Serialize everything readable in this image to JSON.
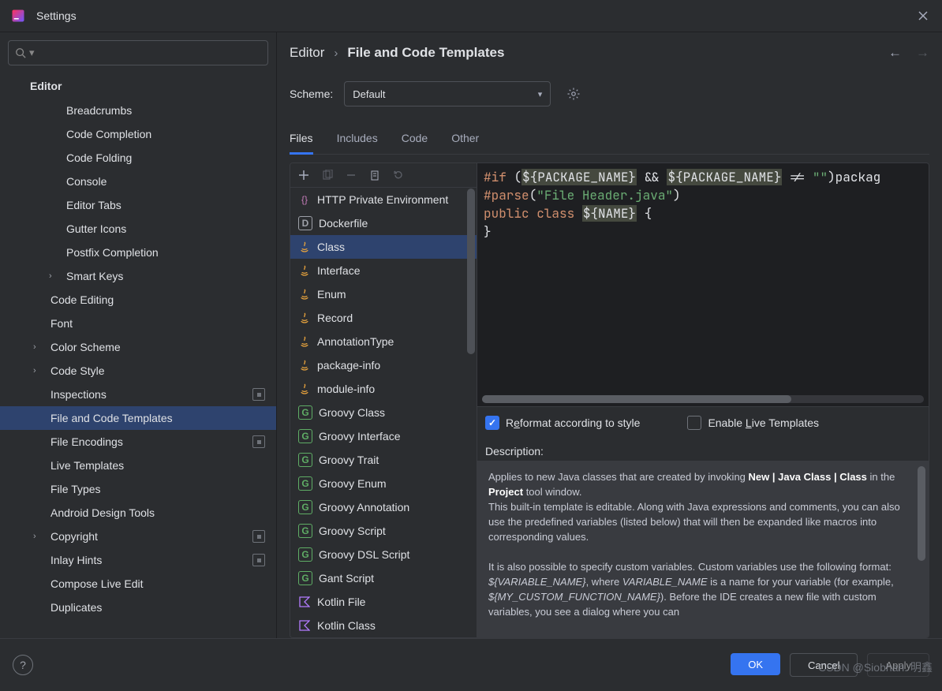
{
  "window": {
    "title": "Settings"
  },
  "search": {
    "placeholder": ""
  },
  "sidebar": {
    "header": "Editor",
    "items": [
      {
        "label": "Breadcrumbs",
        "depth": 2,
        "exp": null,
        "badge": false
      },
      {
        "label": "Code Completion",
        "depth": 2,
        "exp": null,
        "badge": false
      },
      {
        "label": "Code Folding",
        "depth": 2,
        "exp": null,
        "badge": false
      },
      {
        "label": "Console",
        "depth": 2,
        "exp": null,
        "badge": false
      },
      {
        "label": "Editor Tabs",
        "depth": 2,
        "exp": null,
        "badge": false
      },
      {
        "label": "Gutter Icons",
        "depth": 2,
        "exp": null,
        "badge": false
      },
      {
        "label": "Postfix Completion",
        "depth": 2,
        "exp": null,
        "badge": false
      },
      {
        "label": "Smart Keys",
        "depth": 2,
        "exp": ">",
        "badge": false
      },
      {
        "label": "Code Editing",
        "depth": 1,
        "exp": null,
        "badge": false
      },
      {
        "label": "Font",
        "depth": 1,
        "exp": null,
        "badge": false
      },
      {
        "label": "Color Scheme",
        "depth": 1,
        "exp": ">",
        "badge": false
      },
      {
        "label": "Code Style",
        "depth": 1,
        "exp": ">",
        "badge": false
      },
      {
        "label": "Inspections",
        "depth": 1,
        "exp": null,
        "badge": true
      },
      {
        "label": "File and Code Templates",
        "depth": 1,
        "exp": null,
        "badge": false,
        "selected": true
      },
      {
        "label": "File Encodings",
        "depth": 1,
        "exp": null,
        "badge": true
      },
      {
        "label": "Live Templates",
        "depth": 1,
        "exp": null,
        "badge": false
      },
      {
        "label": "File Types",
        "depth": 1,
        "exp": null,
        "badge": false
      },
      {
        "label": "Android Design Tools",
        "depth": 1,
        "exp": null,
        "badge": false
      },
      {
        "label": "Copyright",
        "depth": 1,
        "exp": ">",
        "badge": true
      },
      {
        "label": "Inlay Hints",
        "depth": 1,
        "exp": null,
        "badge": true
      },
      {
        "label": "Compose Live Edit",
        "depth": 1,
        "exp": null,
        "badge": false
      },
      {
        "label": "Duplicates",
        "depth": 1,
        "exp": null,
        "badge": false
      }
    ]
  },
  "breadcrumb": {
    "root": "Editor",
    "leaf": "File and Code Templates"
  },
  "scheme": {
    "label": "Scheme:",
    "value": "Default"
  },
  "tabs": [
    "Files",
    "Includes",
    "Code",
    "Other"
  ],
  "tabs_active": 0,
  "templates": [
    {
      "label": "HTTP Private Environment",
      "icon": "http"
    },
    {
      "label": "Dockerfile",
      "icon": "docker"
    },
    {
      "label": "Class",
      "icon": "java",
      "selected": true
    },
    {
      "label": "Interface",
      "icon": "java"
    },
    {
      "label": "Enum",
      "icon": "java"
    },
    {
      "label": "Record",
      "icon": "java"
    },
    {
      "label": "AnnotationType",
      "icon": "java"
    },
    {
      "label": "package-info",
      "icon": "java"
    },
    {
      "label": "module-info",
      "icon": "java"
    },
    {
      "label": "Groovy Class",
      "icon": "groovy"
    },
    {
      "label": "Groovy Interface",
      "icon": "groovy"
    },
    {
      "label": "Groovy Trait",
      "icon": "groovy"
    },
    {
      "label": "Groovy Enum",
      "icon": "groovy"
    },
    {
      "label": "Groovy Annotation",
      "icon": "groovy"
    },
    {
      "label": "Groovy Script",
      "icon": "groovy"
    },
    {
      "label": "Groovy DSL Script",
      "icon": "groovy"
    },
    {
      "label": "Gant Script",
      "icon": "groovy"
    },
    {
      "label": "Kotlin File",
      "icon": "kotlin"
    },
    {
      "label": "Kotlin Class",
      "icon": "kotlin"
    }
  ],
  "code": {
    "l1a": "#if",
    "l1b": " (",
    "l1c": "${PACKAGE_NAME}",
    "l1d": " && ",
    "l1e": "${PACKAGE_NAME}",
    "l1f": " != ",
    "l1g": "\"\"",
    "l1h": ")packag",
    "l2a": "#parse",
    "l2b": "(",
    "l2c": "\"File Header.java\"",
    "l2d": ")",
    "l3a": "public class ",
    "l3b": "${NAME}",
    "l3c": " {",
    "l4": "}"
  },
  "options": {
    "reformat_pre": "R",
    "reformat_u": "e",
    "reformat_post": "format according to style",
    "reformat_on": true,
    "live_pre": "Enable ",
    "live_u": "L",
    "live_post": "ive Templates",
    "live_on": false
  },
  "description": {
    "label": "Description:",
    "p1a": "Applies to new Java classes that are created by invoking ",
    "p1b": "New | Java Class | Class",
    "p1c": " in the ",
    "p1d": "Project",
    "p1e": " tool window.",
    "p2": "This built-in template is editable. Along with Java expressions and comments, you can also use the predefined variables (listed below) that will then be expanded like macros into corresponding values.",
    "p3a": "It is also possible to specify custom variables. Custom variables use the following format: ",
    "p3b": "${VARIABLE_NAME}",
    "p3c": ", where ",
    "p3d": "VARIABLE_NAME",
    "p3e": " is a name for your variable (for example, ",
    "p3f": "${MY_CUSTOM_FUNCTION_NAME}",
    "p3g": "). Before the IDE creates a new file with custom variables, you see a dialog where you can"
  },
  "footer": {
    "ok": "OK",
    "cancel": "Cancel",
    "apply": "Apply"
  },
  "watermark": "CSDN @Siobhan. 明鑫"
}
